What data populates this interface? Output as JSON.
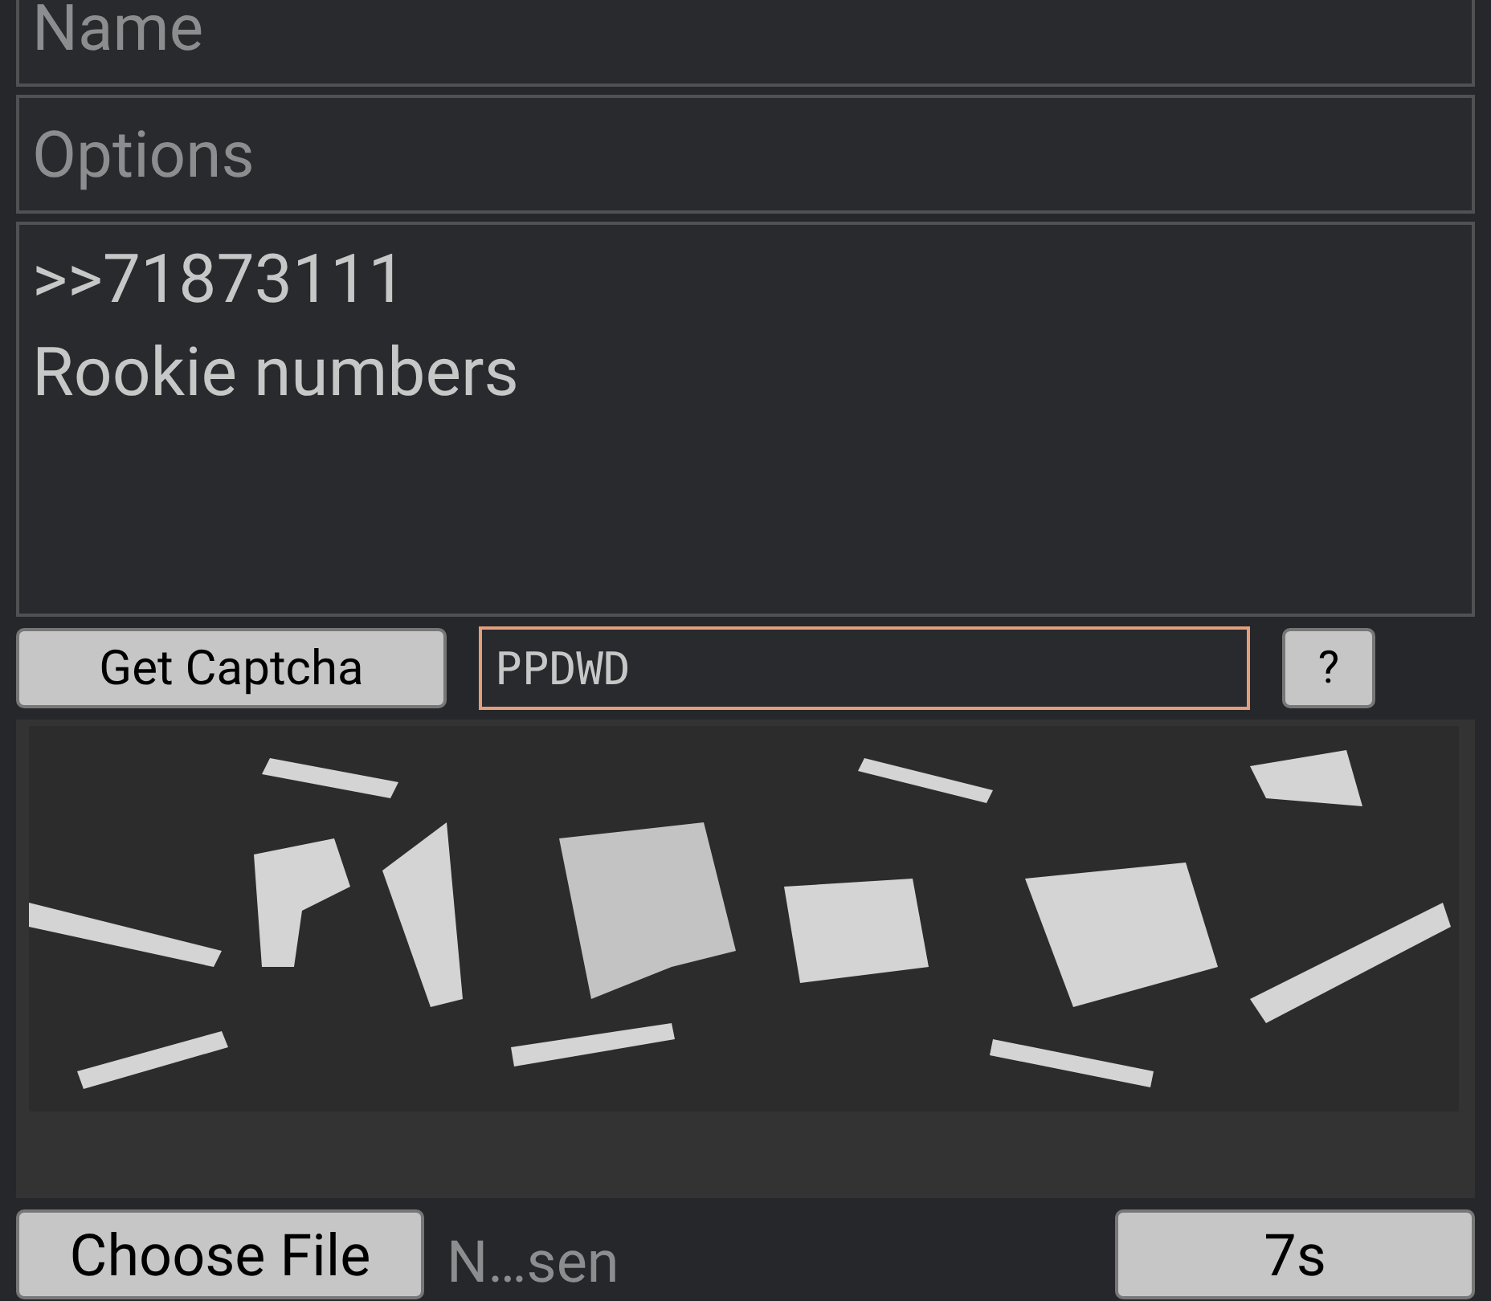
{
  "name_field": {
    "placeholder": "Name"
  },
  "options_field": {
    "placeholder": "Options"
  },
  "comment": {
    "value": ">>71873111\nRookie numbers"
  },
  "captcha": {
    "button": "Get Captcha",
    "answer": "PPDWD",
    "focused": true,
    "help": "?"
  },
  "file": {
    "button": "Choose File",
    "status": "N…sen"
  },
  "submit": {
    "label": "7s"
  }
}
